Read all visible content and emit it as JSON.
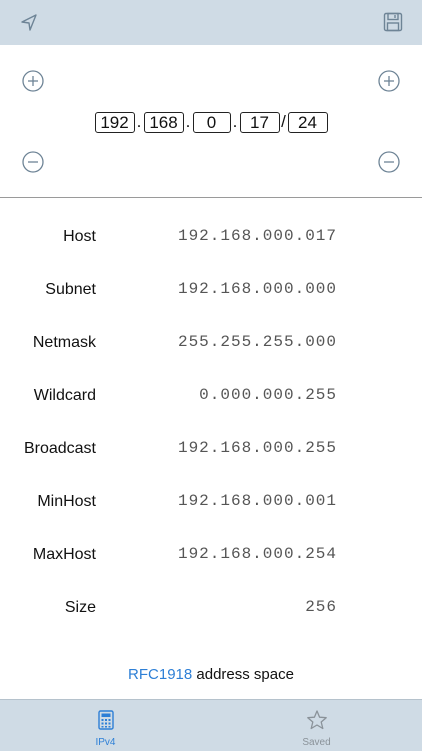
{
  "header": {
    "left_icon": "location-arrow-icon",
    "right_icon": "save-icon"
  },
  "ip": {
    "octets": [
      "192",
      "168",
      "0",
      "17"
    ],
    "dot": ".",
    "slash": "/",
    "prefix": "24",
    "increment_icon": "plus-circle-icon",
    "decrement_icon": "minus-circle-icon"
  },
  "results": [
    {
      "label": "Host",
      "value": "192.168.000.017"
    },
    {
      "label": "Subnet",
      "value": "192.168.000.000"
    },
    {
      "label": "Netmask",
      "value": "255.255.255.000"
    },
    {
      "label": "Wildcard",
      "value": "0.000.000.255"
    },
    {
      "label": "Broadcast",
      "value": "192.168.000.255"
    },
    {
      "label": "MinHost",
      "value": "192.168.000.001"
    },
    {
      "label": "MaxHost",
      "value": "192.168.000.254"
    },
    {
      "label": "Size",
      "value": "256"
    }
  ],
  "note": {
    "link": "RFC1918",
    "text": " address space"
  },
  "tabs": [
    {
      "label": "IPv4",
      "icon": "calculator-icon",
      "active": true
    },
    {
      "label": "Saved",
      "icon": "star-icon",
      "active": false
    }
  ],
  "colors": {
    "bar": "#cfdbe5",
    "accent": "#2d7fd6",
    "icon": "#6e8496"
  }
}
